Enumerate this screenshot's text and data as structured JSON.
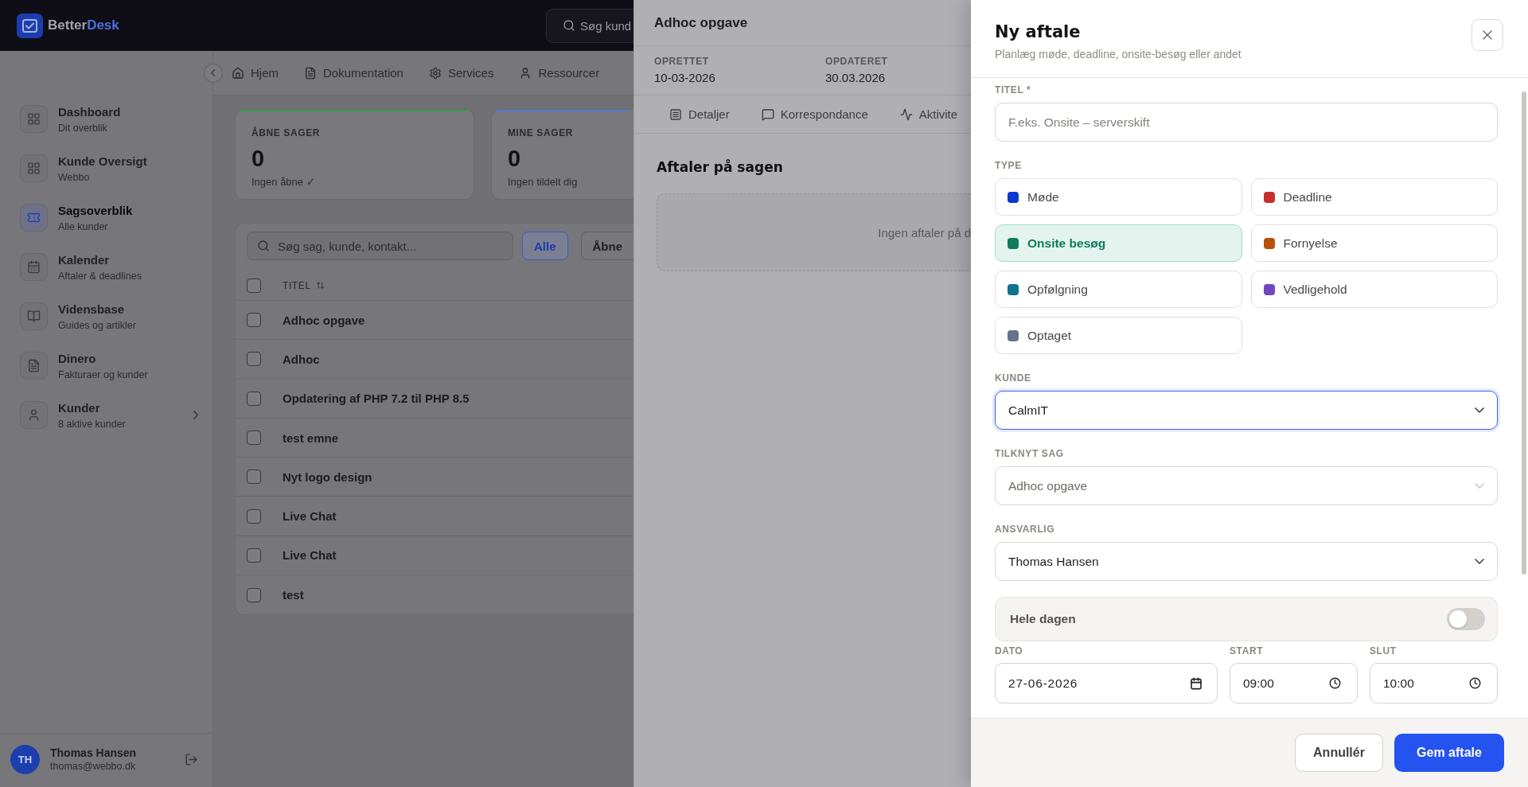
{
  "app": {
    "header": {
      "logo": {
        "parts": [
          "Better",
          "Desk"
        ]
      },
      "search": {
        "placeholder": "Søg kund"
      }
    },
    "sidebar": {
      "items": [
        {
          "title": "Dashboard",
          "subtitle": "Dit overblik",
          "selected": false,
          "expandable": false
        },
        {
          "title": "Kunde Oversigt",
          "subtitle": "Webbo",
          "selected": false,
          "expandable": false
        },
        {
          "title": "Sagsoverblik",
          "subtitle": "Alle kunder",
          "selected": true,
          "expandable": false
        },
        {
          "title": "Kalender",
          "subtitle": "Aftaler & deadlines",
          "selected": false,
          "expandable": false
        },
        {
          "title": "Vidensbase",
          "subtitle": "Guides og artikler",
          "selected": false,
          "expandable": false
        },
        {
          "title": "Dinero",
          "subtitle": "Fakturaer og kunder",
          "selected": false,
          "expandable": false
        },
        {
          "title": "Kunder",
          "subtitle": "8 aktive kunder",
          "selected": false,
          "expandable": true
        }
      ],
      "user": {
        "initials": "TH",
        "name": "Thomas Hansen",
        "email": "thomas@webbo.dk"
      }
    },
    "top_nav": [
      {
        "label": "Hjem"
      },
      {
        "label": "Dokumentation"
      },
      {
        "label": "Services"
      },
      {
        "label": "Ressourcer"
      }
    ],
    "stats": [
      {
        "label": "ÅBNE SAGER",
        "value": "0",
        "note": "Ingen åbne ✓",
        "color": "#4f8f5e"
      },
      {
        "label": "MINE SAGER",
        "value": "0",
        "note": "Ingen tildelt dig",
        "color": "#5b7bb8"
      }
    ],
    "cases": {
      "search": {
        "placeholder": "Søg sag, kunde, kontakt..."
      },
      "filters": [
        {
          "label": "Alle",
          "selected": true
        },
        {
          "label": "Åbne",
          "selected": false
        }
      ],
      "all_checked": false,
      "columns": [
        {
          "label": "TITEL",
          "sortable": true
        }
      ],
      "rows": [
        {
          "title": "Adhoc opgave",
          "checked": false
        },
        {
          "title": "Adhoc",
          "checked": false
        },
        {
          "title": "Opdatering af PHP 7.2 til PHP 8.5",
          "checked": false
        },
        {
          "title": "test emne",
          "checked": false
        },
        {
          "title": "Nyt logo design",
          "checked": false
        },
        {
          "title": "Live Chat",
          "checked": false
        },
        {
          "title": "Live Chat",
          "checked": false
        },
        {
          "title": "test",
          "checked": false
        }
      ]
    }
  },
  "case_panel": {
    "title": "Adhoc opgave",
    "meta": [
      {
        "label": "OPRETTET",
        "value": "10-03-2026"
      },
      {
        "label": "OPDATERET",
        "value": "30.03.2026"
      }
    ],
    "tabs": [
      {
        "label": "Detaljer",
        "selected": false
      },
      {
        "label": "Korrespondance",
        "selected": false
      },
      {
        "label": "Aktivite",
        "selected": false
      }
    ],
    "section": {
      "title": "Aftaler på sagen",
      "empty_text": "Ingen aftaler på d"
    }
  },
  "dialog": {
    "title": "Ny aftale",
    "subtitle": "Planlæg møde, deadline, onsite-besøg eller andet",
    "fields": {
      "title": {
        "label": "TITEL *",
        "placeholder": "F.eks. Onsite – serverskift"
      },
      "type": {
        "label": "TYPE",
        "options": [
          {
            "label": "Møde",
            "color": "#0b36d0",
            "selected": false
          },
          {
            "label": "Deadline",
            "color": "#c72e2a",
            "selected": false
          },
          {
            "label": "Onsite besøg",
            "color": "#0f7a5c",
            "selected": true
          },
          {
            "label": "Fornyelse",
            "color": "#b45309",
            "selected": false
          },
          {
            "label": "Opfølgning",
            "color": "#0e7490",
            "selected": false
          },
          {
            "label": "Vedligehold",
            "color": "#7047c1",
            "selected": false
          },
          {
            "label": "Optaget",
            "color": "#64748b",
            "selected": false
          }
        ]
      },
      "customer": {
        "label": "KUNDE",
        "value": "CalmIT",
        "focused": true,
        "disabled": false
      },
      "case": {
        "label": "TILKNYT SAG",
        "value": "Adhoc opgave",
        "focused": false,
        "disabled": true
      },
      "responsible": {
        "label": "ANSVARLIG",
        "value": "Thomas Hansen",
        "focused": false,
        "disabled": false
      },
      "all_day": {
        "label": "Hele dagen",
        "on": false
      },
      "date": {
        "label": "DATO",
        "value": "27-06-2026"
      },
      "start": {
        "label": "START",
        "value": "09:00"
      },
      "end": {
        "label": "SLUT",
        "value": "10:00"
      }
    },
    "buttons": [
      {
        "label": "Annullér",
        "kind": "secondary"
      },
      {
        "label": "Gem aftale",
        "kind": "primary"
      }
    ]
  }
}
